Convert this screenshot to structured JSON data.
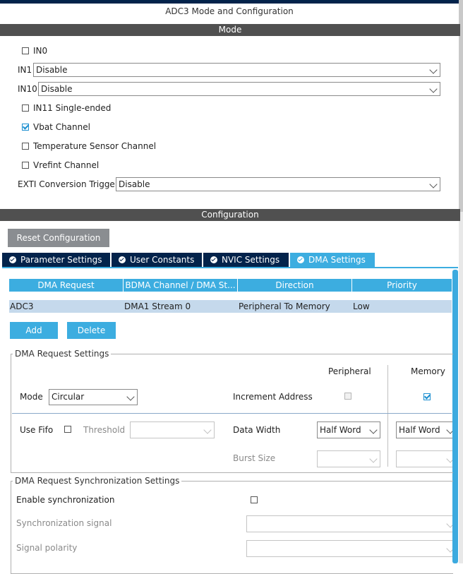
{
  "window": {
    "title": "ADC3 Mode and Configuration"
  },
  "mode": {
    "header": "Mode",
    "in0": {
      "label": "IN0",
      "checked": false
    },
    "in1": {
      "label": "IN1",
      "value": "Disable"
    },
    "in10": {
      "label": "IN10",
      "value": "Disable"
    },
    "in11": {
      "label": "IN11 Single-ended",
      "checked": false
    },
    "vbat": {
      "label": "Vbat Channel",
      "checked": true
    },
    "temp": {
      "label": "Temperature Sensor Channel",
      "checked": false
    },
    "vrefint": {
      "label": "Vrefint Channel",
      "checked": false
    },
    "exti": {
      "label": "EXTI Conversion Trigger",
      "value": "Disable"
    }
  },
  "configuration": {
    "header": "Configuration",
    "reset_label": "Reset Configuration",
    "tabs": [
      "Parameter Settings",
      "User Constants",
      "NVIC Settings",
      "DMA Settings"
    ],
    "active_tab": "DMA Settings"
  },
  "dma_table": {
    "headers": [
      "DMA Request",
      "BDMA Channel / DMA St...",
      "Direction",
      "Priority"
    ],
    "rows": [
      [
        "ADC3",
        "DMA1 Stream 0",
        "Peripheral To Memory",
        "Low"
      ]
    ],
    "add_label": "Add",
    "delete_label": "Delete"
  },
  "request_settings": {
    "title": "DMA Request Settings",
    "peripheral_header": "Peripheral",
    "memory_header": "Memory",
    "mode_label": "Mode",
    "mode_value": "Circular",
    "increment_label": "Increment Address",
    "peripheral_increment": false,
    "memory_increment": true,
    "use_fifo_label": "Use Fifo",
    "use_fifo": false,
    "threshold_label": "Threshold",
    "threshold_value": "",
    "data_width_label": "Data Width",
    "peripheral_width": "Half Word",
    "memory_width": "Half Word",
    "burst_label": "Burst Size",
    "peripheral_burst": "",
    "memory_burst": ""
  },
  "sync_settings": {
    "title": "DMA Request Synchronization Settings",
    "enable_label": "Enable synchronization",
    "enabled": false,
    "signal_label": "Synchronization signal",
    "signal_value": "",
    "polarity_label": "Signal polarity",
    "polarity_value": ""
  },
  "colors": {
    "tab_active": "#3cade0",
    "tab_inactive": "#03234b",
    "section_bar": "#505050",
    "selected_row": "#c5d9ec"
  }
}
